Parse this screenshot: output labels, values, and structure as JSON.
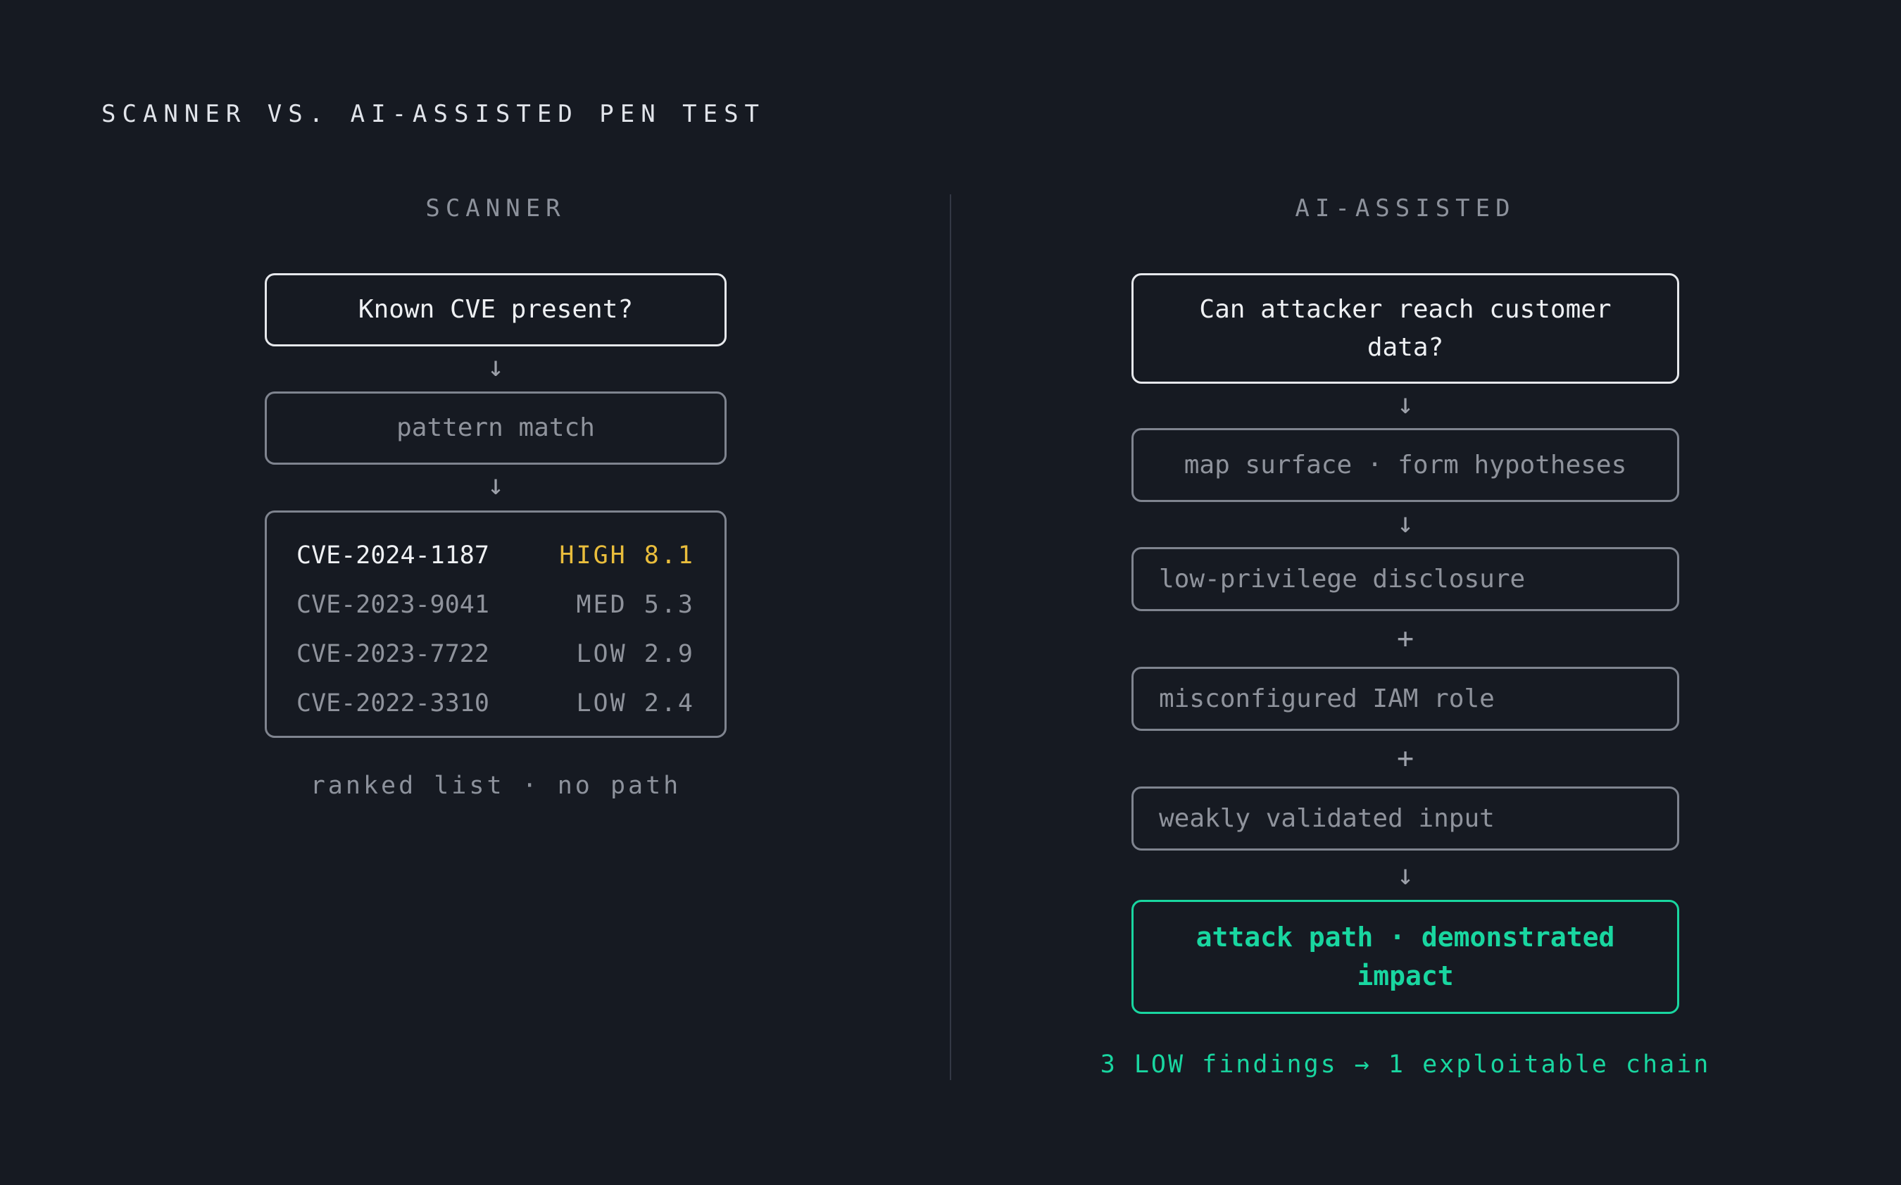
{
  "title": "SCANNER VS. AI-ASSISTED PEN TEST",
  "colors": {
    "background": "#161a22",
    "accent": "#19d6a0",
    "high_severity": "#e9bd3c",
    "muted": "#8f939c"
  },
  "scanner": {
    "heading": "SCANNER",
    "question": "Known CVE present?",
    "arrow": "↓",
    "method": "pattern match",
    "findings": [
      {
        "id": "CVE-2024-1187",
        "severity": "HIGH 8.1"
      },
      {
        "id": "CVE-2023-9041",
        "severity": "MED 5.3"
      },
      {
        "id": "CVE-2023-7722",
        "severity": "LOW 2.9"
      },
      {
        "id": "CVE-2022-3310",
        "severity": "LOW 2.4"
      }
    ],
    "caption": "ranked list · no path"
  },
  "ai_assisted": {
    "heading": "AI-ASSISTED",
    "question": "Can attacker reach customer data?",
    "arrow": "↓",
    "plus": "+",
    "method": "map surface · form hypotheses",
    "findings": [
      "low-privilege disclosure",
      "misconfigured IAM role",
      "weakly validated input"
    ],
    "result": "attack path · demonstrated impact",
    "caption": "3 LOW findings → 1 exploitable chain"
  }
}
